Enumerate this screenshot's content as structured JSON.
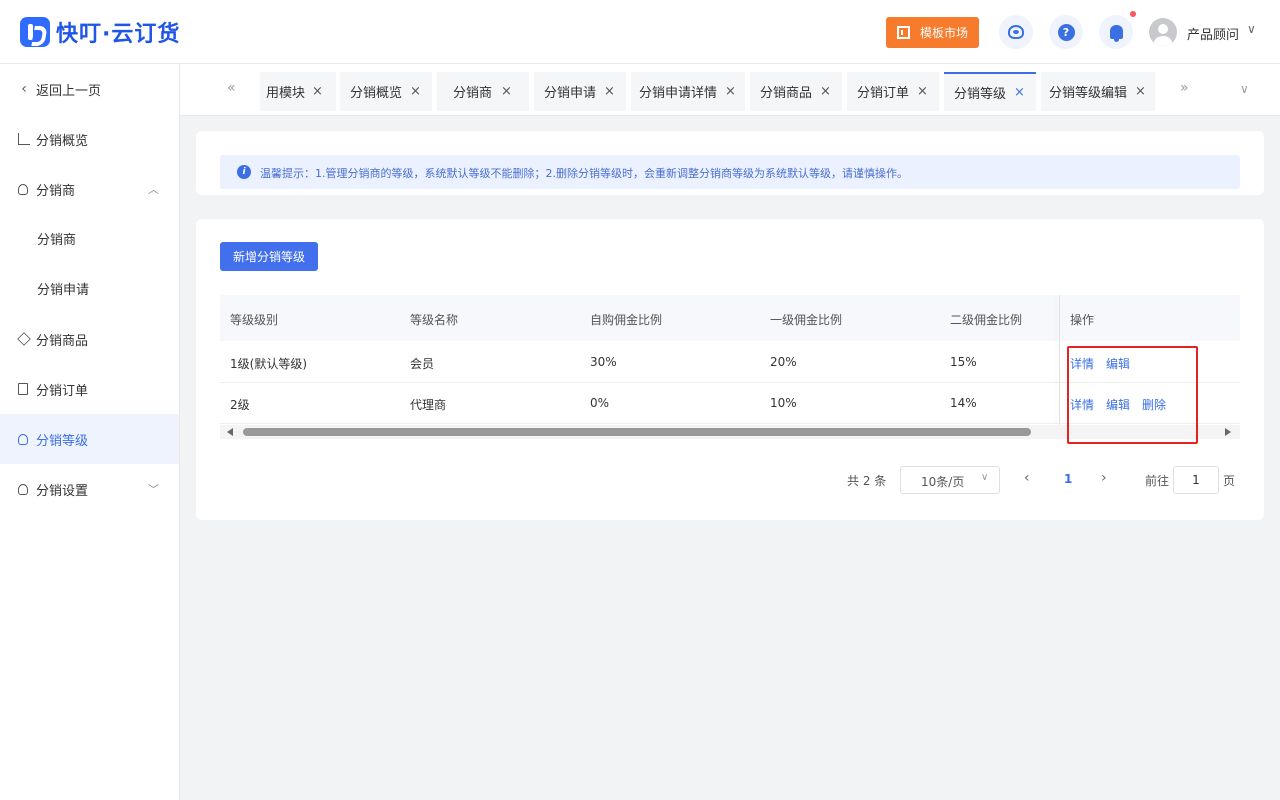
{
  "header": {
    "logo_text": "快叮·云订货",
    "market_label": "模板市场",
    "help_glyph": "?",
    "user_name": "产品顾问",
    "user_chevron": "∨"
  },
  "sidebar": {
    "back_label": "返回上一页",
    "items": [
      {
        "label": "分销概览",
        "icon": "chart-line-icon"
      },
      {
        "label": "分销商",
        "icon": "users-icon",
        "expanded": true
      },
      {
        "label": "分销商",
        "sub": true
      },
      {
        "label": "分销申请",
        "sub": true
      },
      {
        "label": "分销商品",
        "icon": "box-icon"
      },
      {
        "label": "分销订单",
        "icon": "order-icon"
      },
      {
        "label": "分销等级",
        "icon": "user-level-icon",
        "active": true
      },
      {
        "label": "分销设置",
        "icon": "user-settings-icon",
        "expanded": false
      }
    ]
  },
  "tabs": [
    {
      "label": "用模块"
    },
    {
      "label": "分销概览"
    },
    {
      "label": "分销商"
    },
    {
      "label": "分销申请"
    },
    {
      "label": "分销申请详情"
    },
    {
      "label": "分销商品"
    },
    {
      "label": "分销订单"
    },
    {
      "label": "分销等级",
      "active": true
    },
    {
      "label": "分销等级编辑"
    }
  ],
  "tab_close_glyph": "×",
  "notice": {
    "icon_glyph": "i",
    "text": "温馨提示：1.管理分销商的等级，系统默认等级不能删除；2.删除分销等级时，会重新调整分销商等级为系统默认等级，请谨慎操作。"
  },
  "add_button_label": "新增分销等级",
  "table": {
    "columns": [
      "等级级别",
      "等级名称",
      "自购佣金比例",
      "一级佣金比例",
      "二级佣金比例",
      "操作"
    ],
    "rows": [
      {
        "level": "1级(默认等级)",
        "name": "会员",
        "self": "30%",
        "first": "20%",
        "second": "15%",
        "actions": [
          "详情",
          "编辑"
        ]
      },
      {
        "level": "2级",
        "name": "代理商",
        "self": "0%",
        "first": "10%",
        "second": "14%",
        "actions": [
          "详情",
          "编辑",
          "删除"
        ]
      }
    ]
  },
  "pagination": {
    "total": "共 2 条",
    "page_size": "10条/页",
    "current_page": "1",
    "goto_label": "前往",
    "goto_value": "1",
    "goto_suffix": "页"
  },
  "colors": {
    "primary": "#3b6fe3",
    "market_orange": "#f77b2c",
    "highlight_red": "#e32222"
  }
}
